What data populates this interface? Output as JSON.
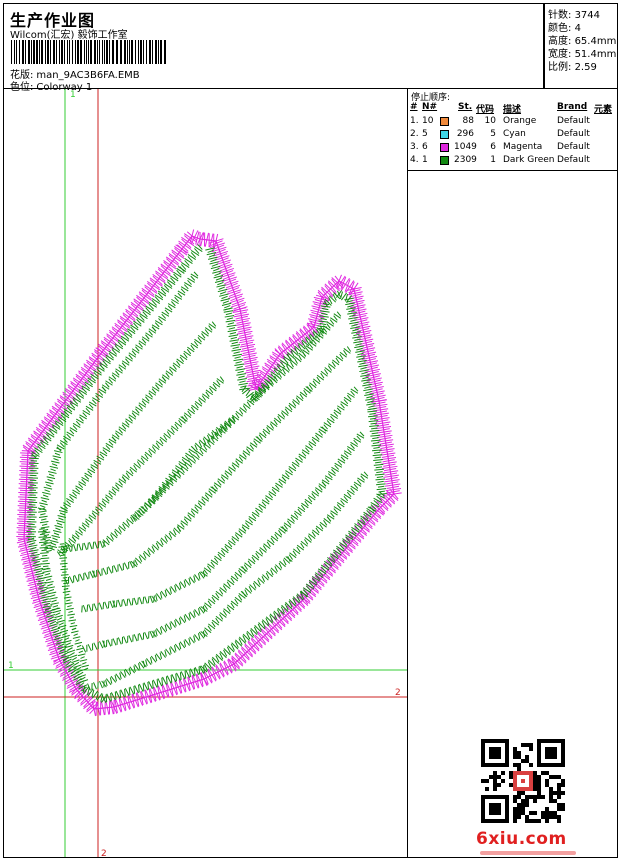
{
  "header": {
    "title": "生产作业图",
    "company": "Wilcom(汇宏) 毅饰工作室",
    "design_label": "花版:",
    "design_file": "man_9AC3B6FA.EMB",
    "colorway_label": "色位:",
    "colorway": "Colorway 1"
  },
  "stats": [
    {
      "label": "针数:",
      "value": "3744"
    },
    {
      "label": "颜色:",
      "value": "4"
    },
    {
      "label": "高度:",
      "value": "65.4mm"
    },
    {
      "label": "宽度:",
      "value": "51.4mm"
    },
    {
      "label": "比例:",
      "value": "2.59"
    }
  ],
  "stop_sequence": {
    "title": "停止顺序:",
    "headers": {
      "hash": "#",
      "n": "N#",
      "st": "St.",
      "code": "代码",
      "desc": "描述",
      "brand": "Brand",
      "elem": "元素"
    },
    "rows": [
      {
        "index": "1.",
        "n": "10",
        "color": "#f08a3c",
        "st": "88",
        "code": "10",
        "desc": "Orange",
        "brand": "Default"
      },
      {
        "index": "2.",
        "n": "5",
        "color": "#3fd6e6",
        "st": "296",
        "code": "5",
        "desc": "Cyan",
        "brand": "Default"
      },
      {
        "index": "3.",
        "n": "6",
        "color": "#e028e0",
        "st": "1049",
        "code": "6",
        "desc": "Magenta",
        "brand": "Default"
      },
      {
        "index": "4.",
        "n": "1",
        "color": "#138a13",
        "st": "2309",
        "code": "1",
        "desc": "Dark Green",
        "brand": "Default"
      }
    ]
  },
  "guides": {
    "v1_label": "1",
    "v2_label": "2",
    "h1_label": "1",
    "h2_label": "2"
  },
  "design_colors": {
    "outline": "#e028e0",
    "fill": "#138a13",
    "guide_green": "#33cc33",
    "guide_red": "#cc2222"
  },
  "watermark": {
    "text": "6xiu.com",
    "color": "#e02020"
  }
}
